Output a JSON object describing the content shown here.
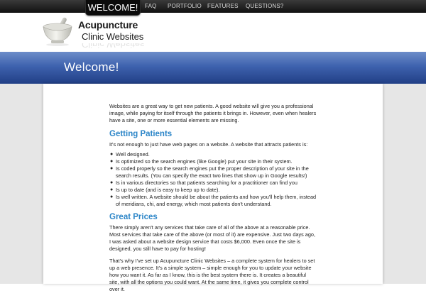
{
  "nav": {
    "active": "WELCOME!",
    "items": [
      "FAQ",
      "PORTFOLIO",
      "FEATURES",
      "QUESTIONS?"
    ]
  },
  "logo": {
    "line1": "Acupuncture",
    "line2": "Clinic Websites"
  },
  "banner": {
    "title": "Welcome!"
  },
  "content": {
    "intro": "Websites are a great way to get new patients. A good website will give you a professional image, while paying for itself through the patients it brings in. However, even when healers have a site, one or more essential elements are missing.",
    "heading1": "Getting Patients",
    "p1": "It's not enough to just have web pages on a website. A website that attracts patients is:",
    "bullets": [
      "Well designed.",
      "Is optimized so the search engines (like Google) put your site in their system.",
      "Is coded properly so the search engines put the proper description of your site in the search results. (You can specify the exact two lines that show up in Google results!)",
      "Is in various directories so that patients searching for a practitioner can find you",
      "Is up to date (and is easy to keep up to date).",
      "Is well written. A website should be about the patients and how you'll help them, instead of meridians, chi, and energy, which most patients don't understand."
    ],
    "heading2": "Great Prices",
    "p2": "There simply aren't any services that take care of all of the above at a reasonable price. Most services that take care of the above (or most of it) are expensive. Just two days ago, I was asked about a website design service that costs $6,000. Even once the site is designed, you still have to pay for hosting!",
    "p3": "That's why I've set up Acupuncture Clinic Websites – a complete system for healers to set up a web presence. It's a simple system – simple enough for you to update your website how you want it. As far as I know, this is the best system there is. It creates a beautiful site, with all the options you could want. At the same time, it gives you complete control over it."
  },
  "colors": {
    "accent_heading": "#2d86c8",
    "banner_blue": "#3e62ae",
    "nav_bg": "#111111"
  }
}
